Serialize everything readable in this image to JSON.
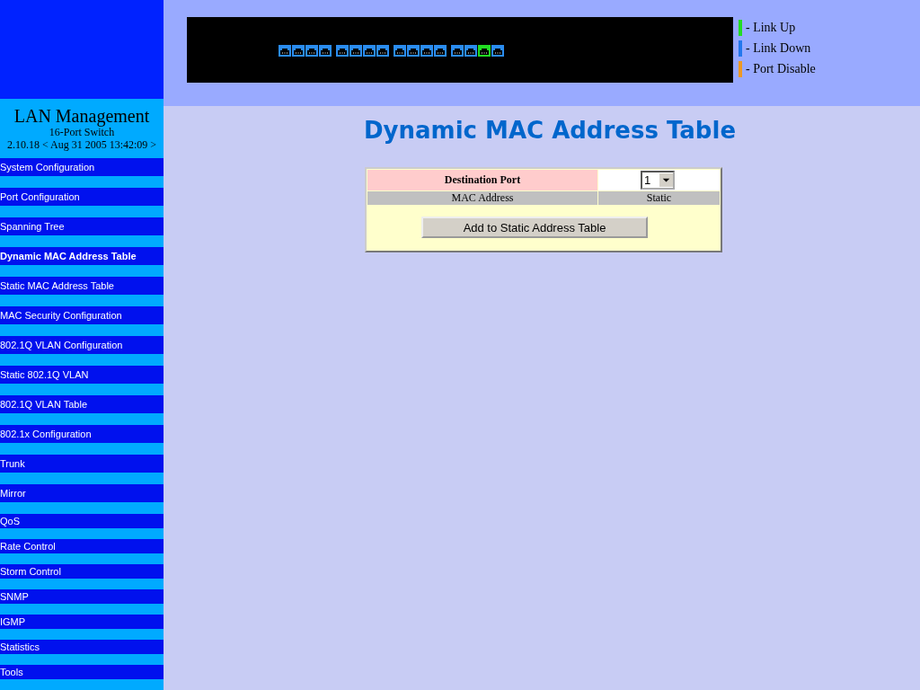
{
  "sidebar": {
    "title": "LAN Management",
    "subtitle": "16-Port Switch",
    "version": "2.10.18 < Aug 31 2005 13:42:09 >",
    "items": [
      {
        "label": "System Configuration",
        "selected": false
      },
      {
        "label": "Port Configuration",
        "selected": false
      },
      {
        "label": "Spanning Tree",
        "selected": false
      },
      {
        "label": "Dynamic MAC Address Table",
        "selected": true
      },
      {
        "label": "Static MAC Address Table",
        "selected": false
      },
      {
        "label": "MAC Security Configuration",
        "selected": false
      },
      {
        "label": "802.1Q VLAN Configuration",
        "selected": false
      },
      {
        "label": "Static 802.1Q VLAN",
        "selected": false
      },
      {
        "label": "802.1Q VLAN Table",
        "selected": false
      },
      {
        "label": "802.1x Configuration",
        "selected": false
      },
      {
        "label": "Trunk",
        "selected": false
      },
      {
        "label": "Mirror",
        "selected": false
      },
      {
        "label": "QoS",
        "selected": false
      },
      {
        "label": "Rate Control",
        "selected": false
      },
      {
        "label": "Storm Control",
        "selected": false
      },
      {
        "label": "SNMP",
        "selected": false
      },
      {
        "label": "IGMP",
        "selected": false
      },
      {
        "label": "Statistics",
        "selected": false
      },
      {
        "label": " Tools",
        "selected": false
      }
    ]
  },
  "switch_panel": {
    "ports": [
      {
        "link_up": false
      },
      {
        "link_up": false
      },
      {
        "link_up": false
      },
      {
        "link_up": false
      },
      {
        "link_up": false
      },
      {
        "link_up": false
      },
      {
        "link_up": false
      },
      {
        "link_up": false
      },
      {
        "link_up": false
      },
      {
        "link_up": false
      },
      {
        "link_up": false
      },
      {
        "link_up": false
      },
      {
        "link_up": false
      },
      {
        "link_up": false
      },
      {
        "link_up": true
      },
      {
        "link_up": false
      }
    ]
  },
  "legend": [
    {
      "label": "- Link Up",
      "color": "#22dd22"
    },
    {
      "label": "- Link Down",
      "color": "#2277ee"
    },
    {
      "label": "- Port Disable",
      "color": "#ee9922"
    }
  ],
  "page_title": "Dynamic MAC Address Table",
  "form": {
    "port_label": "Destination Port",
    "port_value": "1",
    "columns": [
      "MAC Address",
      "Static"
    ],
    "button": "Add to Static Address Table"
  }
}
